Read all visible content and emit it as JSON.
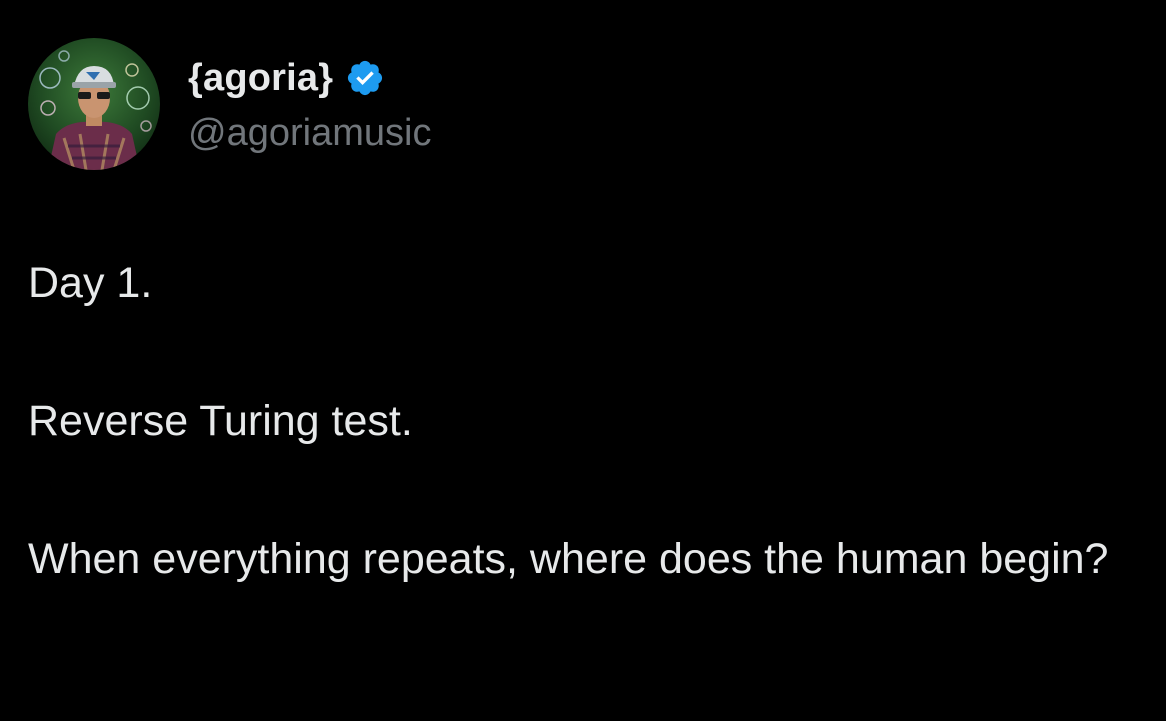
{
  "tweet": {
    "author": {
      "display_name": "{agoria}",
      "handle": "@agoriamusic",
      "verified": true,
      "avatar_icon": "avatar-photo",
      "verified_icon": "verified-badge-icon"
    },
    "paragraphs": [
      "Day 1.",
      "Reverse Turing test.",
      "When everything repeats, where does the human begin?"
    ]
  },
  "colors": {
    "background": "#000000",
    "primary_text": "#e7e9ea",
    "secondary_text": "#71767b",
    "verified_blue": "#1d9bf0"
  }
}
